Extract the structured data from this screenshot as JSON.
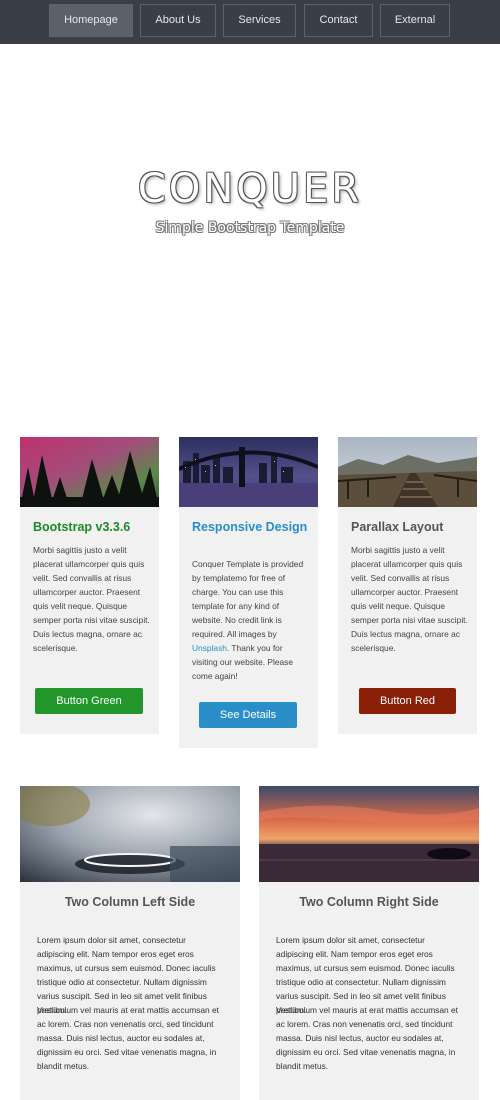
{
  "nav": {
    "items": [
      {
        "label": "Homepage"
      },
      {
        "label": "About Us"
      },
      {
        "label": "Services"
      },
      {
        "label": "Contact"
      },
      {
        "label": "External"
      }
    ]
  },
  "hero": {
    "title": "CONQUER",
    "subtitle": "Simple Bootstrap Template"
  },
  "cards": [
    {
      "title": "Bootstrap v3.3.6",
      "title_color": "#1e8a24",
      "text": "Morbi sagittis justo a velit placerat ullamcorper quis quis velit. Sed convallis at risus ullamcorper auctor. Praesent quis velit neque. Quisque semper porta nisi vitae suscipit. Duis lectus magna, ornare ac scelerisque.",
      "button": "Button Green",
      "button_color": "#22962b"
    },
    {
      "title": "Responsive Design",
      "title_color": "#2a8fc8",
      "text_before": "Conquer Template is provided by templatemo for free of charge. You can use this template for any kind of website. No credit link is required. All images by ",
      "link": "Unsplash",
      "text_after": ". Thank you for visiting our website. Please come again!",
      "button": "See Details",
      "button_color": "#2a8fc8"
    },
    {
      "title": "Parallax Layout",
      "title_color": "#555555",
      "text": "Morbi sagittis justo a velit placerat ullamcorper quis quis velit. Sed convallis at risus ullamcorper auctor. Praesent quis velit neque. Quisque semper porta nisi vitae suscipit. Duis lectus magna, ornare ac scelerisque.",
      "button": "Button Red",
      "button_color": "#8a2008"
    }
  ],
  "columns": [
    {
      "title": "Two Column Left Side",
      "p1": "Lorem ipsum dolor sit amet, consectetur adipiscing elit. Nam tempor eros eget eros maximus, ut cursus sem euismod. Donec iaculis tristique odio at consectetur. Nullam dignissim varius suscipit. Sed in leo sit amet velit finibus pretium.",
      "p2": "Vestibulum vel mauris at erat mattis accumsan et ac lorem. Cras non venenatis orci, sed tincidunt massa. Duis nisl lectus, auctor eu sodales at, dignissim eu orci. Sed vitae venenatis magna, in blandit metus."
    },
    {
      "title": "Two Column Right Side",
      "p1": "Lorem ipsum dolor sit amet, consectetur adipiscing elit. Nam tempor eros eget eros maximus, ut cursus sem euismod. Donec iaculis tristique odio at consectetur. Nullam dignissim varius suscipit. Sed in leo sit amet velit finibus pretium.",
      "p2": "Vestibulum vel mauris at erat mattis accumsan et ac lorem. Cras non venenatis orci, sed tincidunt massa. Duis nisl lectus, auctor eu sodales at, dignissim eu orci. Sed vitae venenatis magna, in blandit metus."
    }
  ]
}
